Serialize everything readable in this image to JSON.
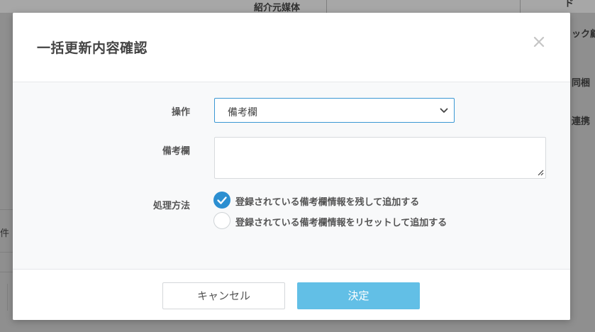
{
  "background": {
    "header_label": "紹介元媒体",
    "right_fragment_1": "ド",
    "right_fragment_2": "ック顧",
    "right_fragment_3": "同梱",
    "right_fragment_4": "連携",
    "left_fragment": "件"
  },
  "dialog": {
    "title": "一括更新内容確認",
    "close_icon": "close-icon",
    "fields": {
      "operation_label": "操作",
      "operation_value": "備考欄",
      "remarks_label": "備考欄",
      "remarks_value": "",
      "method_label": "処理方法"
    },
    "options": [
      {
        "label": "登録されている備考欄情報を残して追加する",
        "checked": true
      },
      {
        "label": "登録されている備考欄情報をリセットして追加する",
        "checked": false
      }
    ],
    "buttons": {
      "cancel": "キャンセル",
      "confirm": "決定"
    }
  },
  "colors": {
    "accent": "#2c8fd1",
    "confirm_button": "#62bfe6",
    "overlay": "#8f8f8f"
  }
}
